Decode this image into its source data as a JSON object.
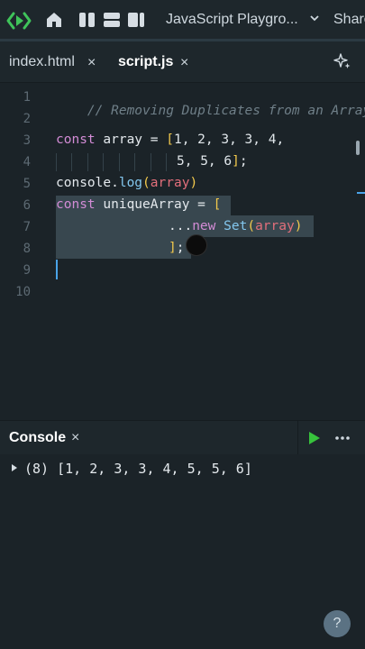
{
  "topbar": {
    "project_title": "JavaScript Playgro...",
    "share_label": "Share"
  },
  "tabs": [
    {
      "label": "index.html",
      "close": "×"
    },
    {
      "label": "script.js",
      "close": "×"
    }
  ],
  "editor": {
    "line_numbers": [
      "1",
      "2",
      "3",
      "4",
      "5",
      "6",
      "7",
      "8",
      "9",
      "10"
    ],
    "lines": {
      "l1": {
        "comment": "// Removing Duplicates from an Array"
      },
      "l3": {
        "kw": "const",
        "name": "array",
        "eq": "=",
        "bracket": "[",
        "nums": "1, 2, 3, 3, 4,"
      },
      "l4": {
        "nums": "5, 5, 6",
        "bracket": "]",
        "semi": ";"
      },
      "l5": {
        "obj": "console.",
        "fn": "log",
        "open": "(",
        "arg": "array",
        "close": ")"
      },
      "l6": {
        "kw": "const",
        "name": "uniqueArray",
        "eq": "=",
        "bracket": "["
      },
      "l7": {
        "spread": "...",
        "kw": "new",
        "cls": "Set",
        "open": "(",
        "arg": "array",
        "close": ")"
      },
      "l8": {
        "bracket": "]",
        "semi": ";"
      }
    }
  },
  "console": {
    "title": "Console",
    "close": "×",
    "output": "(8) [1, 2, 3, 3, 4, 5, 5, 6]",
    "help_label": "?"
  },
  "colors": {
    "keyword": "#d38cd6",
    "function": "#83c7ee",
    "bracket": "#f2c94c",
    "argument": "#e26f7b",
    "comment": "#6f7f88",
    "run": "#37c23c",
    "logo": "#3fc45a"
  }
}
